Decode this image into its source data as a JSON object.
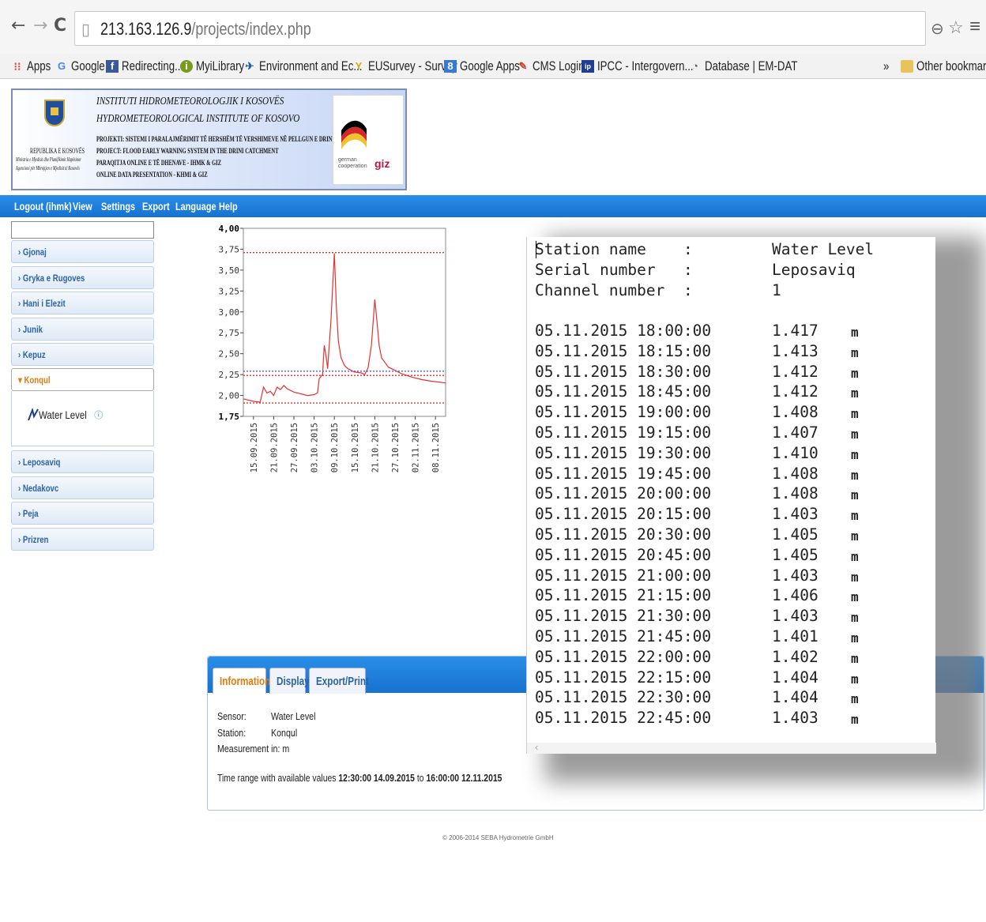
{
  "browser": {
    "url_host": "213.163.126.9",
    "url_path": "/projects/index.php",
    "bookmarks": [
      "Apps",
      "Google",
      "Redirecting...",
      "MyiLibrary",
      "Environment and Ec...",
      "EUSurvey - Survey",
      "Google Apps",
      "CMS Login",
      "IPCC - Intergovern...",
      "Database | EM-DAT"
    ],
    "overflow": "»",
    "other_bookmarks": "Other bookmarks"
  },
  "banner": {
    "title_ks": "INSTITUTI HIDROMETEOROLOGJIK I KOSOVËS",
    "title_en": "HYDROMETEOROLOGICAL INSTITUTE OF KOSOVO",
    "line_project_ks": "PROJEKTI: SISTEMI I PARALAJMËRIMIT TË HERSHËM TË VERSHIMEVE NË PELLGUN E DRINIT",
    "line_project_en": "PROJECT: FLOOD EARLY WARNING SYSTEM IN THE DRINI CATCHMENT",
    "line_data_ks": "PARAQITJA ONLINE E TË DHENAVE - IHMK & GIZ",
    "line_data_en": "ONLINE DATA PRESENTATION - KHMI & GIZ",
    "emblem_lines": [
      "REPUBLIKA E KOSOVËS",
      "Ministria e Mjedisit dhe Planifikimit Hapësinor",
      "Agencioni për Mbrojtjen e Mjedisit të Kosovës"
    ],
    "partner_text": "german cooperation",
    "giz": "giz"
  },
  "menu": [
    "Logout (ihmk)",
    "View",
    "Settings",
    "Export",
    "Language",
    "Help"
  ],
  "sidebar": {
    "stations": [
      "Gjonaj",
      "Gryka e Rugoves",
      "Hani i Elezit",
      "Junik",
      "Kepuz",
      "Konqul",
      "Leposaviq",
      "Nedakovc",
      "Peja",
      "Prizren"
    ],
    "open_station": "Konqul",
    "sensor": "Water Level"
  },
  "chart_data": {
    "type": "line",
    "y_ticks": [
      "4,00",
      "3,75",
      "3,50",
      "3,25",
      "3,00",
      "2,75",
      "2,50",
      "2,25",
      "2,00",
      "1,75"
    ],
    "ylim": [
      1.75,
      4.0
    ],
    "x_ticks": [
      "15.09.2015",
      "21.09.2015",
      "27.09.2015",
      "03.10.2015",
      "09.10.2015",
      "15.10.2015",
      "21.10.2015",
      "27.10.2015",
      "02.11.2015",
      "08.11.2015"
    ],
    "x_range_days": [
      0,
      60
    ],
    "threshold_lines": [
      {
        "value": 3.71,
        "color": "#e53030",
        "style": "dotted"
      },
      {
        "value": 2.29,
        "color": "#3a4fd8",
        "style": "dotted"
      },
      {
        "value": 2.24,
        "color": "#e53030",
        "style": "dotted"
      },
      {
        "value": 1.91,
        "color": "#e53030",
        "style": "dotted"
      }
    ],
    "series": [
      {
        "color": "#e53030",
        "points": [
          [
            0,
            1.96
          ],
          [
            3,
            1.93
          ],
          [
            5,
            1.92
          ],
          [
            6,
            2.1
          ],
          [
            7,
            2.03
          ],
          [
            8,
            2.05
          ],
          [
            9,
            2.0
          ],
          [
            10,
            2.1
          ],
          [
            11,
            2.07
          ],
          [
            12,
            2.12
          ],
          [
            13,
            2.08
          ],
          [
            15,
            2.04
          ],
          [
            17,
            2.02
          ],
          [
            19,
            2.0
          ],
          [
            21,
            2.01
          ],
          [
            22,
            2.03
          ],
          [
            22.5,
            2.2
          ],
          [
            23.5,
            2.25
          ],
          [
            24,
            2.6
          ],
          [
            24.6,
            2.45
          ],
          [
            25,
            2.32
          ],
          [
            26,
            2.9
          ],
          [
            27,
            3.7
          ],
          [
            27.6,
            3.05
          ],
          [
            28.2,
            2.65
          ],
          [
            29,
            2.45
          ],
          [
            30,
            2.36
          ],
          [
            31,
            2.32
          ],
          [
            32,
            2.3
          ],
          [
            33,
            2.28
          ],
          [
            35,
            2.27
          ],
          [
            36,
            2.25
          ],
          [
            37,
            2.33
          ],
          [
            38,
            2.6
          ],
          [
            39,
            3.15
          ],
          [
            39.6,
            2.9
          ],
          [
            40.3,
            2.6
          ],
          [
            41,
            2.45
          ],
          [
            43,
            2.34
          ],
          [
            45,
            2.3
          ],
          [
            47,
            2.26
          ],
          [
            50,
            2.22
          ],
          [
            53,
            2.19
          ],
          [
            56,
            2.17
          ],
          [
            60,
            2.15
          ]
        ]
      }
    ]
  },
  "info": {
    "tabs": [
      "Information",
      "Display",
      "Export/Print"
    ],
    "sensor_key": "Sensor:",
    "sensor_val": "Water Level",
    "station_key": "Station:",
    "station_val": "Konqul",
    "unit_line": "Measurement in: m",
    "range_prefix": "Time range with available values",
    "range_from": "12:30:00 14.09.2015",
    "range_to_word": "to",
    "range_to": "16:00:00 12.11.2015"
  },
  "footer": "© 2006-2014 SEBA Hydrometrie GmbH",
  "popup": {
    "header": [
      [
        "Station name",
        ":",
        "Water Level"
      ],
      [
        "Serial number",
        ":",
        "Leposaviq"
      ],
      [
        "Channel number",
        ":",
        "1"
      ]
    ],
    "rows": [
      [
        "05.11.2015 18:00:00",
        "1.417",
        "m"
      ],
      [
        "05.11.2015 18:15:00",
        "1.413",
        "m"
      ],
      [
        "05.11.2015 18:30:00",
        "1.412",
        "m"
      ],
      [
        "05.11.2015 18:45:00",
        "1.412",
        "m"
      ],
      [
        "05.11.2015 19:00:00",
        "1.408",
        "m"
      ],
      [
        "05.11.2015 19:15:00",
        "1.407",
        "m"
      ],
      [
        "05.11.2015 19:30:00",
        "1.410",
        "m"
      ],
      [
        "05.11.2015 19:45:00",
        "1.408",
        "m"
      ],
      [
        "05.11.2015 20:00:00",
        "1.408",
        "m"
      ],
      [
        "05.11.2015 20:15:00",
        "1.403",
        "m"
      ],
      [
        "05.11.2015 20:30:00",
        "1.405",
        "m"
      ],
      [
        "05.11.2015 20:45:00",
        "1.405",
        "m"
      ],
      [
        "05.11.2015 21:00:00",
        "1.403",
        "m"
      ],
      [
        "05.11.2015 21:15:00",
        "1.406",
        "m"
      ],
      [
        "05.11.2015 21:30:00",
        "1.403",
        "m"
      ],
      [
        "05.11.2015 21:45:00",
        "1.401",
        "m"
      ],
      [
        "05.11.2015 22:00:00",
        "1.402",
        "m"
      ],
      [
        "05.11.2015 22:15:00",
        "1.404",
        "m"
      ],
      [
        "05.11.2015 22:30:00",
        "1.404",
        "m"
      ],
      [
        "05.11.2015 22:45:00",
        "1.403",
        "m"
      ]
    ]
  }
}
